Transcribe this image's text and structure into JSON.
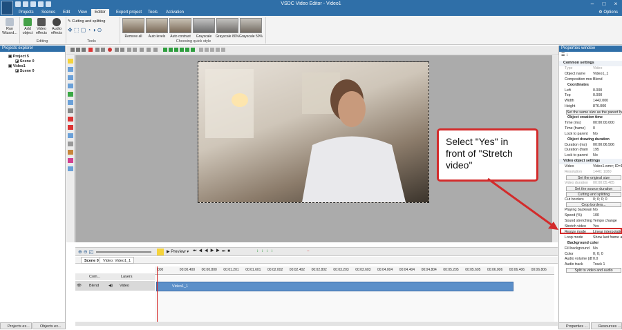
{
  "titlebar": {
    "title": "VSDC Video Editor - Video1",
    "options_label": "Options"
  },
  "menu": {
    "tabs": [
      "Projects",
      "Scenes",
      "Edit",
      "View",
      "Editor",
      "Export project",
      "Tools",
      "Activation"
    ],
    "active_index": 4
  },
  "ribbon": {
    "run_wizard": "Run Wizard...",
    "add_object": "Add object",
    "video_effects": "Video effects",
    "audio_effects": "Audio effects",
    "cutting_splitting": "Cutting and splitting",
    "editing_label": "Editing",
    "tools_label": "Tools",
    "quick_style_label": "Choosing quick style",
    "styles": [
      "Remove all",
      "Auto levels",
      "Auto contrast",
      "Grayscale",
      "Grayscale 80%",
      "Grayscale 50%"
    ]
  },
  "projects_explorer": {
    "title": "Projects explorer",
    "tree": [
      "Project 5",
      "Scene 0",
      "Video1",
      "Scene 0"
    ],
    "bottom_tabs": [
      "Projects ex...",
      "Objects ex..."
    ]
  },
  "callout": {
    "text": "Select \"Yes\" in front of \"Stretch video\""
  },
  "timeline": {
    "preview_label": "Preview",
    "tabs": [
      "Scene 0",
      "Video: Video1_1"
    ],
    "layer_header": [
      "Com...",
      "Layers"
    ],
    "track": {
      "blend": "Blend",
      "name": "Video"
    },
    "clip_label": "Video1_1",
    "ticks": [
      "000",
      "00:00.400",
      "00:00.800",
      "00:01.201",
      "00:01.601",
      "00:02.002",
      "00:02.402",
      "00:02.802",
      "00:03.203",
      "00:03.603",
      "00:04.004",
      "00:04.404",
      "00:04.804",
      "00:05.205",
      "00:05.605",
      "00:06.006",
      "00:06.406",
      "00:06.806"
    ]
  },
  "properties": {
    "title": "Properties window",
    "bottom_tabs": [
      "Properties ...",
      "Resources ..."
    ],
    "rows": [
      {
        "kind": "sec",
        "k": "Common settings"
      },
      {
        "kind": "gray",
        "k": "Type",
        "v": "Video"
      },
      {
        "kind": "row",
        "k": "Object name",
        "v": "Video1_1"
      },
      {
        "kind": "row",
        "k": "Composition mode",
        "v": "Blend"
      },
      {
        "kind": "sec2",
        "k": "Coordinates"
      },
      {
        "kind": "row",
        "k": "Left",
        "v": "0.000"
      },
      {
        "kind": "row",
        "k": "Top",
        "v": "0.000"
      },
      {
        "kind": "row",
        "k": "Width",
        "v": "1442.000"
      },
      {
        "kind": "row",
        "k": "Height",
        "v": "876.000"
      },
      {
        "kind": "btn",
        "k": "Set the same size as the parent has"
      },
      {
        "kind": "sec2",
        "k": "Object creation time"
      },
      {
        "kind": "row",
        "k": "Time (ms)",
        "v": "00:00:00.000"
      },
      {
        "kind": "row",
        "k": "Time (frame)",
        "v": "0"
      },
      {
        "kind": "row",
        "k": "Lock to parent",
        "v": "No"
      },
      {
        "kind": "sec2",
        "k": "Object drawing duration"
      },
      {
        "kind": "row",
        "k": "Duration (ms)",
        "v": "00:00:06.506"
      },
      {
        "kind": "row",
        "k": "Duration (fram",
        "v": "195"
      },
      {
        "kind": "row",
        "k": "Lock to parent",
        "v": "No"
      },
      {
        "kind": "sec",
        "k": "Video object settings"
      },
      {
        "kind": "row",
        "k": "Video",
        "v": "Video1.wmv; ID=1"
      },
      {
        "kind": "gray",
        "k": "Resolution",
        "v": "1440; 1080"
      },
      {
        "kind": "btn",
        "k": "Set the original size"
      },
      {
        "kind": "gray",
        "k": "Video duration",
        "v": "00:00:05.485"
      },
      {
        "kind": "btn",
        "k": "Set the source duration"
      },
      {
        "kind": "btn",
        "k": "Cutting and splitting"
      },
      {
        "kind": "row",
        "k": "Cut borders",
        "v": "0; 0; 0; 0"
      },
      {
        "kind": "btn",
        "k": "Crop borders..."
      },
      {
        "kind": "row",
        "k": "Playing backward",
        "v": "No"
      },
      {
        "kind": "row",
        "k": "Speed (%)",
        "v": "100"
      },
      {
        "kind": "row",
        "k": "Sound stretching",
        "v": "Tempo change"
      },
      {
        "kind": "row",
        "k": "Stretch video",
        "v": "Yes"
      },
      {
        "kind": "row",
        "k": "Resize mode",
        "v": "Linear interpolation"
      },
      {
        "kind": "row",
        "k": "Loop mode",
        "v": "Show last frame at"
      },
      {
        "kind": "sec2",
        "k": "Background color"
      },
      {
        "kind": "row",
        "k": "Fill background",
        "v": "No"
      },
      {
        "kind": "row",
        "k": "Color",
        "v": "0; 0; 0"
      },
      {
        "kind": "row",
        "k": "Audio volume (dB)",
        "v": "0.0"
      },
      {
        "kind": "row",
        "k": "Audio track",
        "v": "Track 1"
      },
      {
        "kind": "btn",
        "k": "Split to video and audio"
      }
    ]
  },
  "colors": {
    "accent": "#2f6fa8",
    "highlight": "#d32b2b",
    "clip": "#5b8fc9"
  }
}
